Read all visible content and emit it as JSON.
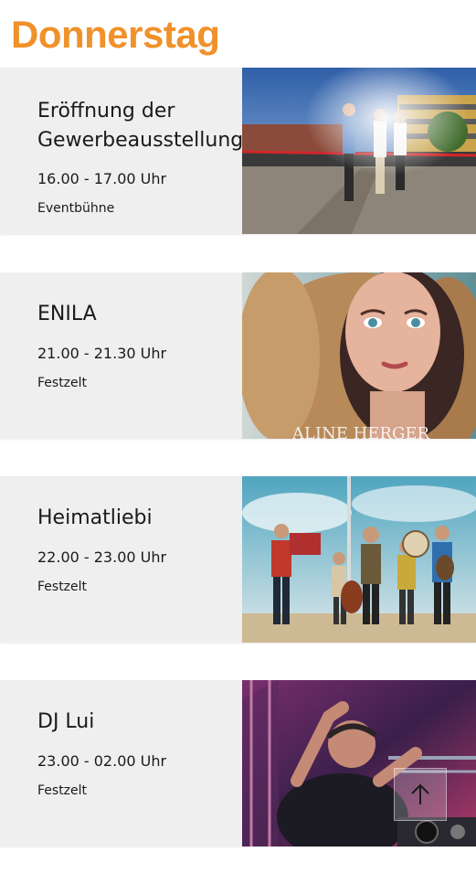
{
  "day": "Donnerstag",
  "events": [
    {
      "title_line1": "Eröffnung der",
      "title_line2": "Gewerbeausstellung",
      "time": "16.00 - 17.00 Uhr",
      "venue": "Eventbühne"
    },
    {
      "title_line1": "ENILA",
      "title_line2": "",
      "time": "21.00 - 21.30 Uhr",
      "venue": "Festzelt",
      "photo_caption": "ALINE HERGER"
    },
    {
      "title_line1": "Heimatliebi",
      "title_line2": "",
      "time": "22.00 - 23.00 Uhr",
      "venue": "Festzelt"
    },
    {
      "title_line1": "DJ Lui",
      "title_line2": "",
      "time": "23.00 - 02.00 Uhr",
      "venue": "Festzelt"
    }
  ],
  "colors": {
    "accent": "#f0912a",
    "card_bg": "#efeff0"
  },
  "icons": {
    "scroll_top": "arrow-up-icon"
  }
}
